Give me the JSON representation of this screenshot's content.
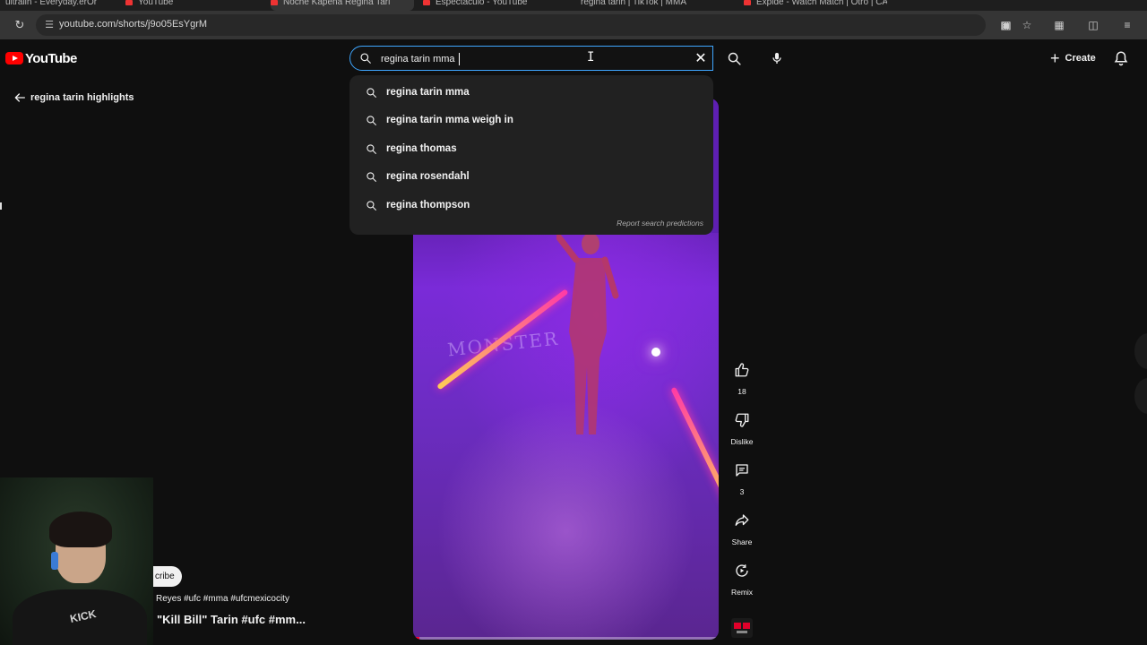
{
  "browser": {
    "url": "youtube.com/shorts/j9o05EsYgrM",
    "tabs": [
      "ultralin - Everyday.erOr",
      "YouTube",
      "Noche Kapena Regina Tari",
      "Espectaculo - YouTube",
      "regina tarin | TikTok | MMA",
      "Expide - Watch Match | Otro | CAT"
    ]
  },
  "header": {
    "logo_text": "YouTube",
    "search_value": "regina tarin mma",
    "create_label": "Create"
  },
  "page": {
    "back_title": "regina tarin highlights"
  },
  "suggestions": {
    "items": [
      "regina tarin mma",
      "regina tarin mma weigh in",
      "regina thomas",
      "regina rosendahl",
      "regina thompson"
    ],
    "report_label": "Report search predictions"
  },
  "video": {
    "monster_text": "MONSTER",
    "subscribe_partial": "cribe",
    "description": "Reyes #ufc #mma #ufcmexicocity",
    "title": "\"Kill Bill\" Tarin #ufc #mm...",
    "progress_fraction": 0.02
  },
  "actions": {
    "like_count": "18",
    "dislike_label": "Dislike",
    "comment_count": "3",
    "share_label": "Share",
    "remix_label": "Remix"
  },
  "webcam": {
    "shirt_text": "KICK"
  },
  "icons": {
    "search": "search-icon",
    "mic": "microphone-icon",
    "bell": "bell-icon",
    "back": "arrow-left-icon",
    "like": "thumbs-up-icon",
    "dislike": "thumbs-down-icon",
    "comment": "comment-icon",
    "share": "share-icon",
    "remix": "remix-icon"
  }
}
